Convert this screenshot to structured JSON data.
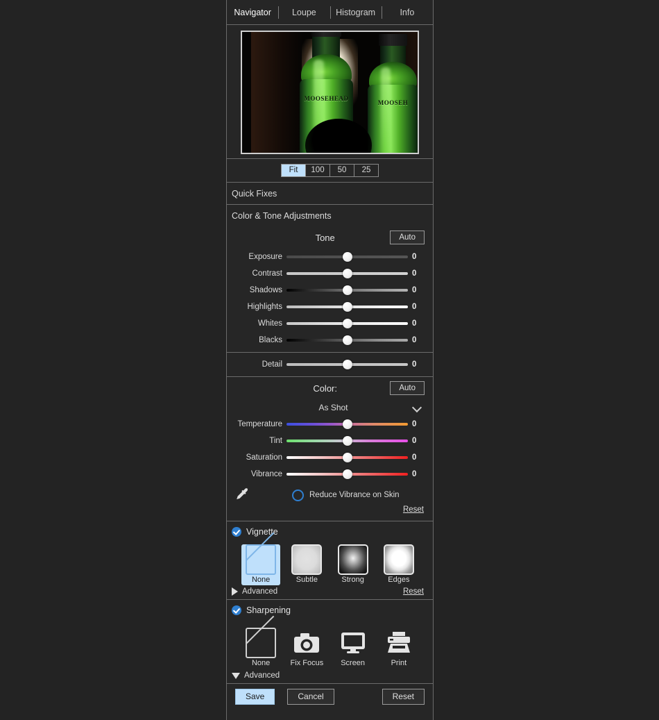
{
  "tabs": [
    {
      "label": "Navigator",
      "active": true
    },
    {
      "label": "Loupe",
      "active": false
    },
    {
      "label": "Histogram",
      "active": false
    },
    {
      "label": "Info",
      "active": false
    }
  ],
  "navigator": {
    "image_alt": "Two green Moosehead beer bottles backlit on a dark background",
    "bottle_label": "MOOSEHEAD",
    "bottle_label_2": "MOOSEH"
  },
  "zoom_levels": [
    {
      "label": "Fit",
      "active": true
    },
    {
      "label": "100",
      "active": false
    },
    {
      "label": "50",
      "active": false
    },
    {
      "label": "25",
      "active": false
    }
  ],
  "quick_fixes": {
    "title": "Quick Fixes"
  },
  "color_tone": {
    "title": "Color & Tone Adjustments",
    "tone": {
      "title": "Tone",
      "auto_label": "Auto",
      "sliders": [
        {
          "label": "Exposure",
          "value": "0",
          "pos": 50,
          "grad": "g-exposure"
        },
        {
          "label": "Contrast",
          "value": "0",
          "pos": 50,
          "grad": "g-contrast"
        },
        {
          "label": "Shadows",
          "value": "0",
          "pos": 50,
          "grad": "g-shadows"
        },
        {
          "label": "Highlights",
          "value": "0",
          "pos": 50,
          "grad": "g-highlights"
        },
        {
          "label": "Whites",
          "value": "0",
          "pos": 50,
          "grad": "g-whites"
        },
        {
          "label": "Blacks",
          "value": "0",
          "pos": 50,
          "grad": "g-blacks"
        }
      ]
    },
    "detail": {
      "sliders": [
        {
          "label": "Detail",
          "value": "0",
          "pos": 50,
          "grad": "g-detail"
        }
      ]
    },
    "color": {
      "title": "Color:",
      "auto_label": "Auto",
      "preset": "As Shot",
      "sliders": [
        {
          "label": "Temperature",
          "value": "0",
          "pos": 50,
          "grad": "g-temperature"
        },
        {
          "label": "Tint",
          "value": "0",
          "pos": 50,
          "grad": "g-tint"
        },
        {
          "label": "Saturation",
          "value": "0",
          "pos": 50,
          "grad": "g-saturation"
        },
        {
          "label": "Vibrance",
          "value": "0",
          "pos": 50,
          "grad": "g-vibrance"
        }
      ],
      "reduce_vibrance_label": "Reduce Vibrance on Skin",
      "reduce_vibrance_checked": false,
      "reset_label": "Reset"
    }
  },
  "vignette": {
    "title": "Vignette",
    "enabled": true,
    "options": [
      {
        "label": "None",
        "selected": true,
        "style": "none"
      },
      {
        "label": "Subtle",
        "selected": false,
        "style": "subtle"
      },
      {
        "label": "Strong",
        "selected": false,
        "style": "strong"
      },
      {
        "label": "Edges",
        "selected": false,
        "style": "edges"
      }
    ],
    "advanced_label": "Advanced",
    "advanced_expanded": false,
    "reset_label": "Reset"
  },
  "sharpening": {
    "title": "Sharpening",
    "enabled": true,
    "options": [
      {
        "label": "None",
        "icon": "slash-box-icon",
        "selected": false
      },
      {
        "label": "Fix Focus",
        "icon": "camera-icon",
        "selected": false
      },
      {
        "label": "Screen",
        "icon": "monitor-icon",
        "selected": false
      },
      {
        "label": "Print",
        "icon": "printer-icon",
        "selected": false
      }
    ],
    "advanced_label": "Advanced",
    "advanced_expanded": true
  },
  "footer": {
    "save_label": "Save",
    "cancel_label": "Cancel",
    "reset_label": "Reset"
  },
  "colors": {
    "accent": "#bfe0fb",
    "checkbox": "#2f7fd0",
    "panel_bg": "#262626",
    "page_bg": "#232323",
    "border": "#6b6b6b"
  }
}
